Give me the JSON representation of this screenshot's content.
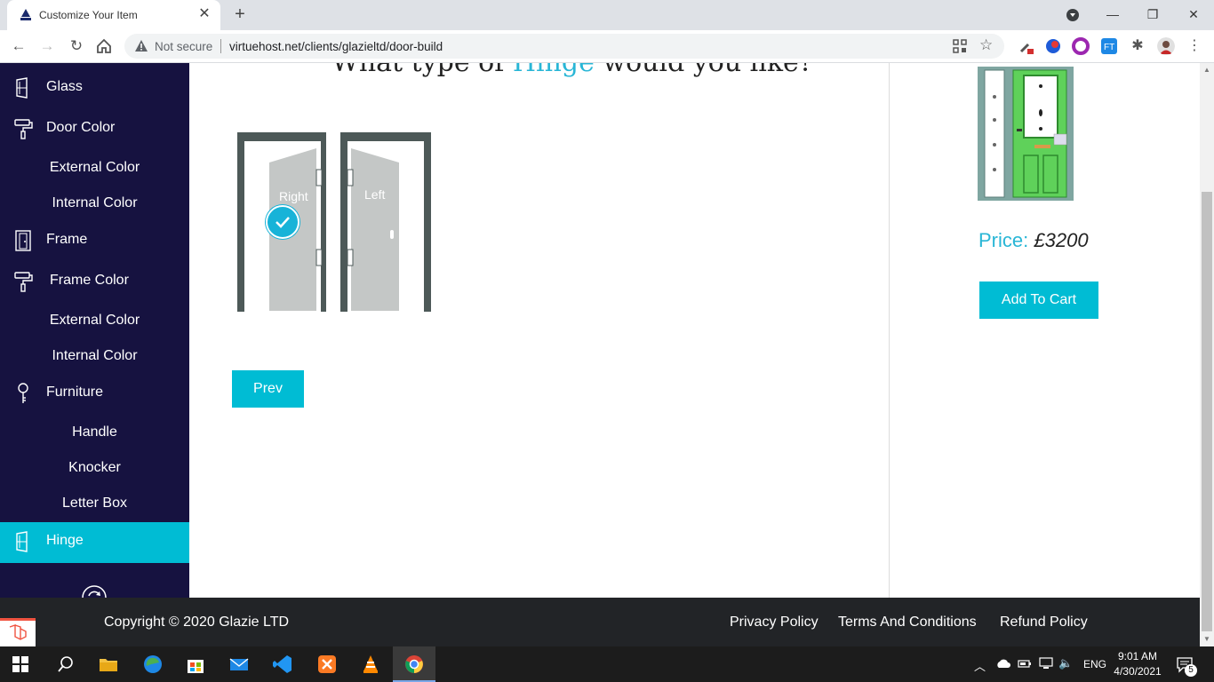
{
  "browser": {
    "tab_title": "Customize Your Item",
    "tab_close": "✕",
    "new_tab": "+",
    "security_label": "Not secure",
    "url": "virtuehost.net/clients/glazieltd/door-build",
    "window_controls": {
      "minimize": "—",
      "maximize": "❐",
      "close": "✕"
    }
  },
  "sidebar": {
    "items": [
      {
        "label": "Glass",
        "icon": "door-glass-icon"
      },
      {
        "label": "Door Color",
        "icon": "paint-roller-icon"
      },
      {
        "label": "External Color"
      },
      {
        "label": "Internal Color"
      },
      {
        "label": "Frame",
        "icon": "frame-icon"
      },
      {
        "label": "Frame Color",
        "icon": "paint-roller-icon"
      },
      {
        "label": "External Color"
      },
      {
        "label": "Internal Color"
      },
      {
        "label": "Furniture",
        "icon": "key-icon"
      },
      {
        "label": "Handle"
      },
      {
        "label": "Knocker"
      },
      {
        "label": "Letter Box"
      },
      {
        "label": "Hinge",
        "icon": "door-glass-icon",
        "active": true
      }
    ],
    "accent_color": "#00bcd4",
    "background_color": "#161240"
  },
  "content": {
    "question_before": "What type of ",
    "question_highlight": "Hinge",
    "question_after": " would you like?",
    "options": [
      {
        "label": "Right",
        "selected": true
      },
      {
        "label": "Left",
        "selected": false
      }
    ],
    "prev_label": "Prev"
  },
  "summary": {
    "price_label": "Price:",
    "price_value": "£3200",
    "cart_label": "Add To Cart"
  },
  "footer": {
    "copyright": "Copyright © 2020 Glazie LTD",
    "links": [
      "Privacy Policy",
      "Terms And Conditions",
      "Refund Policy"
    ]
  },
  "taskbar": {
    "time": "9:01 AM",
    "date": "4/30/2021",
    "language": "ENG",
    "notifications": "5"
  }
}
